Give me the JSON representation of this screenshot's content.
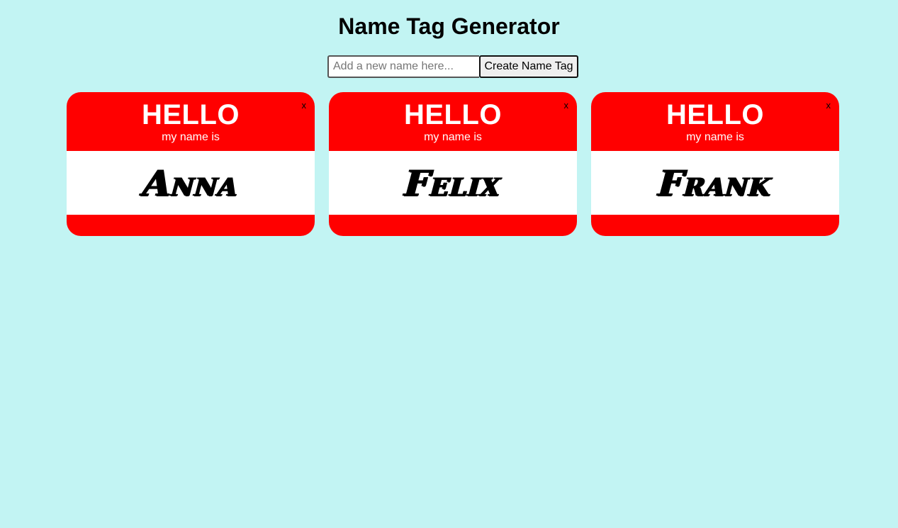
{
  "page": {
    "title": "Name Tag Generator",
    "background": "#c2f4f3"
  },
  "form": {
    "input_placeholder": "Add a new name here...",
    "input_value": "",
    "button_label": "Create Name Tag"
  },
  "tags": [
    {
      "hello": "HELLO",
      "subtitle": "my name is",
      "name": "Anna",
      "close": "x"
    },
    {
      "hello": "HELLO",
      "subtitle": "my name is",
      "name": "Felix",
      "close": "x"
    },
    {
      "hello": "HELLO",
      "subtitle": "my name is",
      "name": "Frank",
      "close": "x"
    }
  ],
  "colors": {
    "tag_red": "#ff0000",
    "tag_white": "#ffffff",
    "text": "#000000"
  }
}
